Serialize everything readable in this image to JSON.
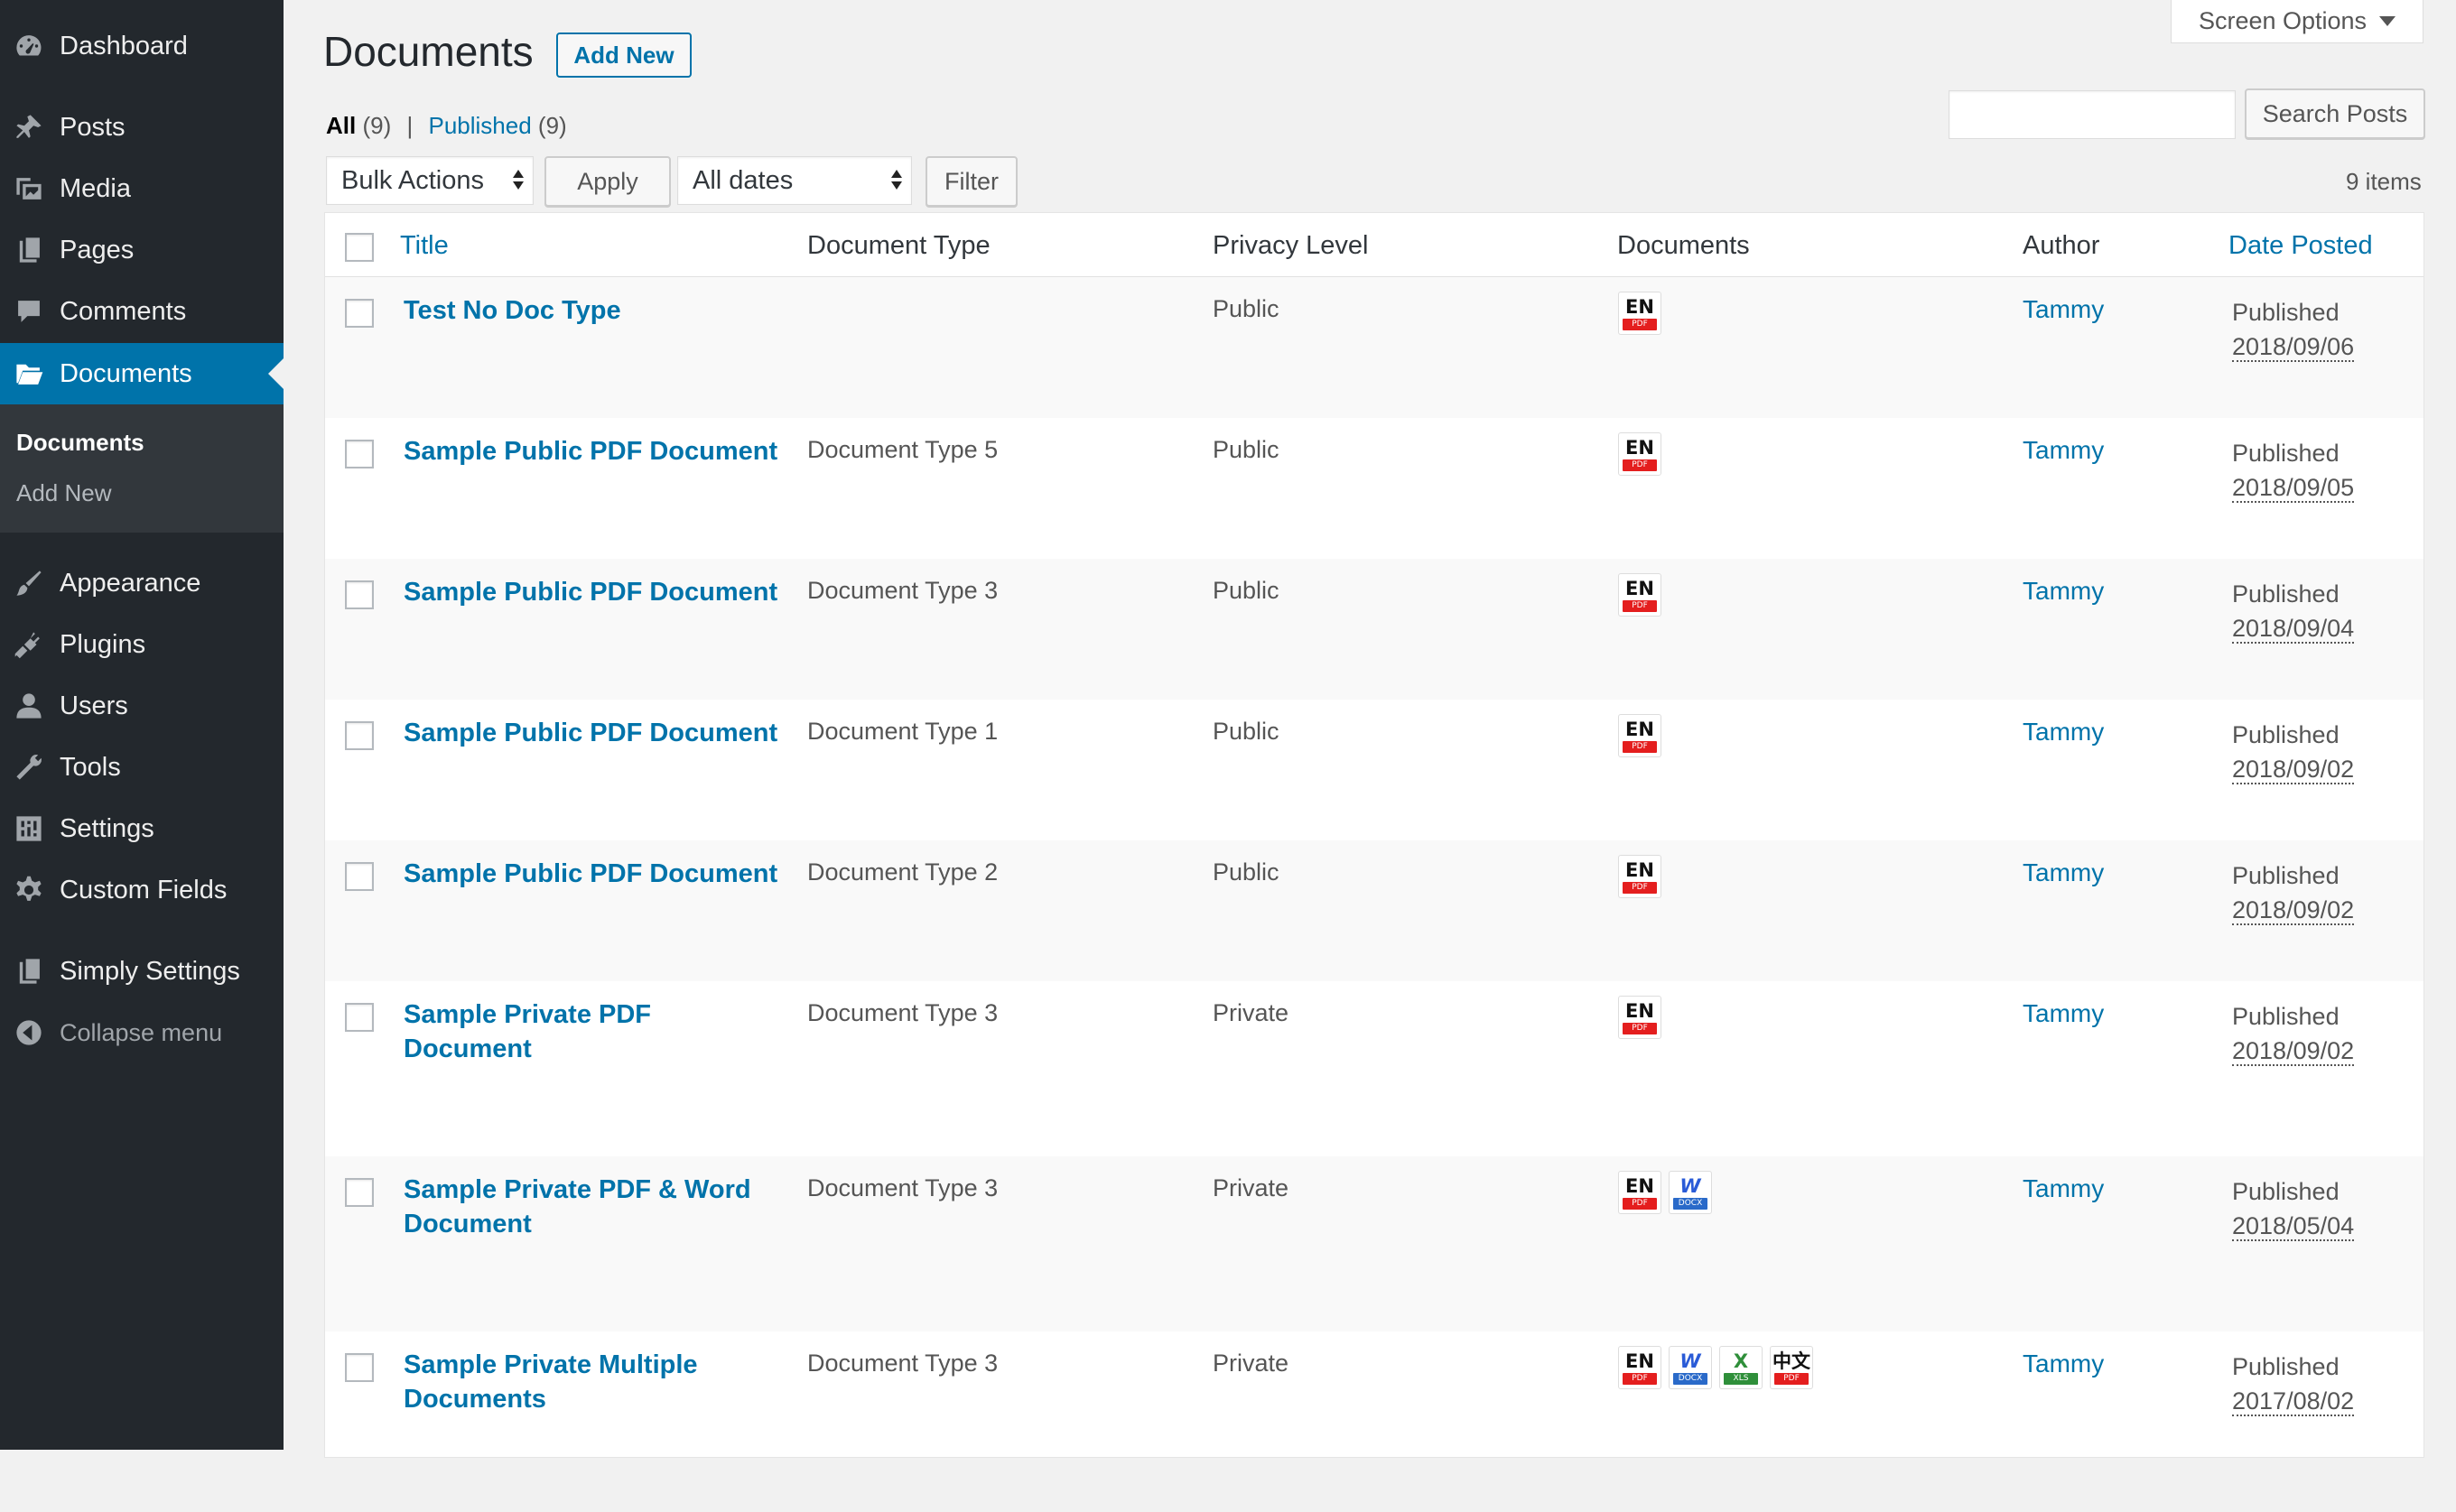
{
  "sidebar": {
    "items": [
      {
        "label": "Dashboard",
        "icon": "dashboard-icon"
      },
      {
        "label": "Posts",
        "icon": "pin-icon"
      },
      {
        "label": "Media",
        "icon": "media-icon"
      },
      {
        "label": "Pages",
        "icon": "pages-icon"
      },
      {
        "label": "Comments",
        "icon": "comment-icon"
      },
      {
        "label": "Documents",
        "icon": "folder-icon",
        "active": true
      },
      {
        "label": "Appearance",
        "icon": "paintbrush-icon"
      },
      {
        "label": "Plugins",
        "icon": "plugin-icon"
      },
      {
        "label": "Users",
        "icon": "user-icon"
      },
      {
        "label": "Tools",
        "icon": "wrench-icon"
      },
      {
        "label": "Settings",
        "icon": "settings-icon"
      },
      {
        "label": "Custom Fields",
        "icon": "gear-icon"
      },
      {
        "label": "Simply Settings",
        "icon": "document-icon"
      }
    ],
    "submenu": {
      "current": "Documents",
      "add_new": "Add New"
    },
    "collapse": "Collapse menu"
  },
  "header": {
    "title": "Documents",
    "add_new": "Add New",
    "screen_options": "Screen Options"
  },
  "views": {
    "all_label": "All",
    "all_count": "(9)",
    "sep": "|",
    "published_label": "Published",
    "published_count": "(9)"
  },
  "search": {
    "placeholder": "",
    "button": "Search Posts"
  },
  "toolbar": {
    "bulk_actions": "Bulk Actions",
    "apply": "Apply",
    "dates": "All dates",
    "filter": "Filter",
    "items_count": "9 items"
  },
  "table": {
    "headers": {
      "title": "Title",
      "doc_type": "Document Type",
      "privacy": "Privacy Level",
      "documents": "Documents",
      "author": "Author",
      "date": "Date Posted"
    },
    "rows": [
      {
        "title": "Test No Doc Type",
        "doc_type": "",
        "privacy": "Public",
        "docs": [
          "pdf-en"
        ],
        "author": "Tammy",
        "status": "Published",
        "date": "2018/09/06"
      },
      {
        "title": "Sample Public PDF Document",
        "doc_type": "Document Type 5",
        "privacy": "Public",
        "docs": [
          "pdf-en"
        ],
        "author": "Tammy",
        "status": "Published",
        "date": "2018/09/05"
      },
      {
        "title": "Sample Public PDF Document",
        "doc_type": "Document Type 3",
        "privacy": "Public",
        "docs": [
          "pdf-en"
        ],
        "author": "Tammy",
        "status": "Published",
        "date": "2018/09/04"
      },
      {
        "title": "Sample Public PDF Document",
        "doc_type": "Document Type 1",
        "privacy": "Public",
        "docs": [
          "pdf-en"
        ],
        "author": "Tammy",
        "status": "Published",
        "date": "2018/09/02"
      },
      {
        "title": "Sample Public PDF Document",
        "doc_type": "Document Type 2",
        "privacy": "Public",
        "docs": [
          "pdf-en"
        ],
        "author": "Tammy",
        "status": "Published",
        "date": "2018/09/02"
      },
      {
        "title": "Sample Private PDF Document",
        "doc_type": "Document Type 3",
        "privacy": "Private",
        "docs": [
          "pdf-en"
        ],
        "author": "Tammy",
        "status": "Published",
        "date": "2018/09/02"
      },
      {
        "title": "Sample Private PDF & Word Document",
        "doc_type": "Document Type 3",
        "privacy": "Private",
        "docs": [
          "pdf-en",
          "docx"
        ],
        "author": "Tammy",
        "status": "Published",
        "date": "2018/05/04"
      },
      {
        "title": "Sample Private Multiple Documents",
        "doc_type": "Document Type 3",
        "privacy": "Private",
        "docs": [
          "pdf-en",
          "docx",
          "xls",
          "pdf-zh"
        ],
        "author": "Tammy",
        "status": "Published",
        "date": "2017/08/02"
      }
    ]
  },
  "doc_icons": {
    "pdf-en": {
      "glyph": "EN",
      "tag": "PDF"
    },
    "pdf-zh": {
      "glyph": "中文",
      "tag": "PDF"
    },
    "docx": {
      "glyph": "W",
      "tag": "DOCX"
    },
    "xls": {
      "glyph": "X",
      "tag": "XLS"
    }
  },
  "colors": {
    "sidebar_bg": "#23282d",
    "accent": "#0073aa",
    "page_bg": "#f1f1f1"
  }
}
